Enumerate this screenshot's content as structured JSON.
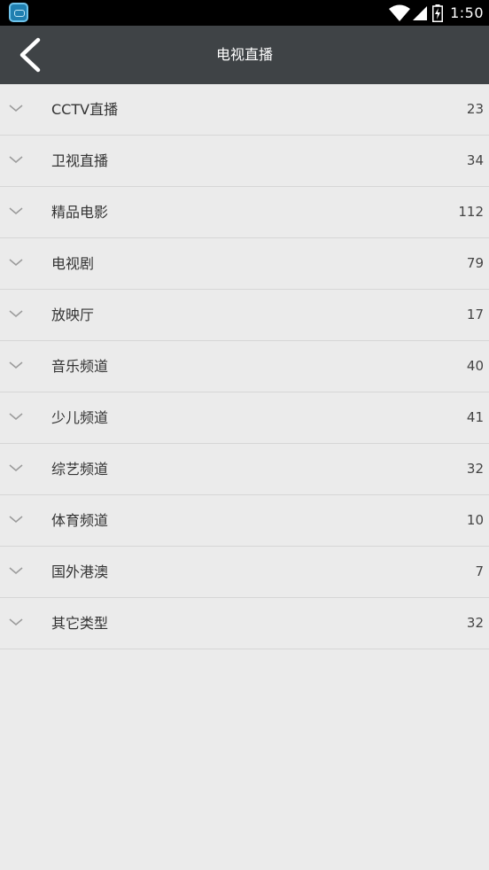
{
  "status_bar": {
    "time": "1:50",
    "app_icon": "app-icon",
    "icons": [
      "wifi-icon",
      "signal-icon",
      "battery-icon"
    ]
  },
  "header": {
    "back_icon": "back-arrow-icon",
    "title": "电视直播"
  },
  "categories": [
    {
      "label": "CCTV直播",
      "count": "23"
    },
    {
      "label": "卫视直播",
      "count": "34"
    },
    {
      "label": "精品电影",
      "count": "112"
    },
    {
      "label": "电视剧",
      "count": "79"
    },
    {
      "label": "放映厅",
      "count": "17"
    },
    {
      "label": "音乐频道",
      "count": "40"
    },
    {
      "label": "少儿频道",
      "count": "41"
    },
    {
      "label": "综艺频道",
      "count": "32"
    },
    {
      "label": "体育频道",
      "count": "10"
    },
    {
      "label": "国外港澳",
      "count": "7"
    },
    {
      "label": "其它类型",
      "count": "32"
    }
  ],
  "colors": {
    "status_bar_bg": "#000000",
    "title_bar_bg": "#3f4346",
    "list_bg": "#ebebeb",
    "divider": "#d6d6d6"
  }
}
